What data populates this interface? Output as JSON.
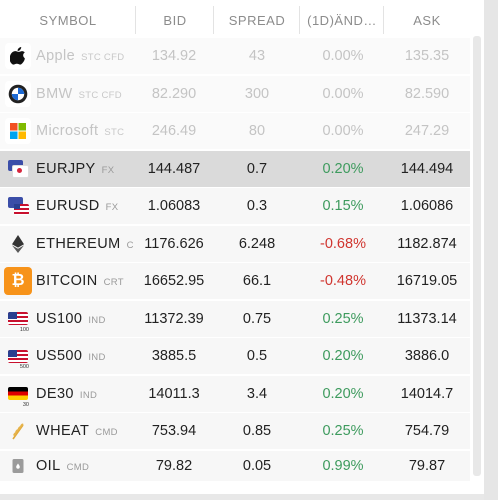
{
  "columns": {
    "symbol": "SYMBOL",
    "bid": "BID",
    "spread": "SPREAD",
    "change": "(1D)ÄND…",
    "ask": "ASK"
  },
  "colors": {
    "positive": "#3e9b5e",
    "negative": "#d0352f",
    "disabled_text": "#c4c4c4",
    "selected_row": "#dadada"
  },
  "rows": [
    {
      "icon": "apple-icon",
      "symbol": "Apple",
      "type": "STC CFD",
      "bid": "134.92",
      "spread": "43",
      "change": "0.00%",
      "ask": "135.35",
      "state": "disabled",
      "trend": "flat"
    },
    {
      "icon": "bmw-icon",
      "symbol": "BMW",
      "type": "STC CFD",
      "bid": "82.290",
      "spread": "300",
      "change": "0.00%",
      "ask": "82.590",
      "state": "disabled",
      "trend": "flat"
    },
    {
      "icon": "microsoft-icon",
      "symbol": "Microsoft",
      "type": "STC",
      "bid": "246.49",
      "spread": "80",
      "change": "0.00%",
      "ask": "247.29",
      "state": "disabled",
      "trend": "flat"
    },
    {
      "icon": "eur-jpy-flag-icon",
      "symbol": "EURJPY",
      "type": "FX",
      "bid": "144.487",
      "spread": "0.7",
      "change": "0.20%",
      "ask": "144.494",
      "state": "selected",
      "trend": "up"
    },
    {
      "icon": "eur-usd-flag-icon",
      "symbol": "EURUSD",
      "type": "FX",
      "bid": "1.06083",
      "spread": "0.3",
      "change": "0.15%",
      "ask": "1.06086",
      "state": "normal",
      "trend": "up"
    },
    {
      "icon": "ethereum-icon",
      "symbol": "ETHEREUM",
      "type": "C",
      "bid": "1176.626",
      "spread": "6.248",
      "change": "-0.68%",
      "ask": "1182.874",
      "state": "normal",
      "trend": "down"
    },
    {
      "icon": "bitcoin-icon",
      "symbol": "BITCOIN",
      "type": "CRT",
      "bid": "16652.95",
      "spread": "66.1",
      "change": "-0.48%",
      "ask": "16719.05",
      "state": "normal",
      "trend": "down"
    },
    {
      "icon": "us-flag-icon",
      "badge": "100",
      "symbol": "US100",
      "type": "IND",
      "bid": "11372.39",
      "spread": "0.75",
      "change": "0.25%",
      "ask": "11373.14",
      "state": "normal",
      "trend": "up"
    },
    {
      "icon": "us-flag-icon",
      "badge": "500",
      "symbol": "US500",
      "type": "IND",
      "bid": "3885.5",
      "spread": "0.5",
      "change": "0.20%",
      "ask": "3886.0",
      "state": "normal",
      "trend": "up"
    },
    {
      "icon": "germany-flag-icon",
      "badge": "30",
      "symbol": "DE30",
      "type": "IND",
      "bid": "14011.3",
      "spread": "3.4",
      "change": "0.20%",
      "ask": "14014.7",
      "state": "normal",
      "trend": "up"
    },
    {
      "icon": "wheat-icon",
      "symbol": "WHEAT",
      "type": "CMD",
      "bid": "753.94",
      "spread": "0.85",
      "change": "0.25%",
      "ask": "754.79",
      "state": "normal",
      "trend": "up"
    },
    {
      "icon": "oil-barrel-icon",
      "symbol": "OIL",
      "type": "CMD",
      "bid": "79.82",
      "spread": "0.05",
      "change": "0.99%",
      "ask": "79.87",
      "state": "normal",
      "trend": "up"
    }
  ]
}
